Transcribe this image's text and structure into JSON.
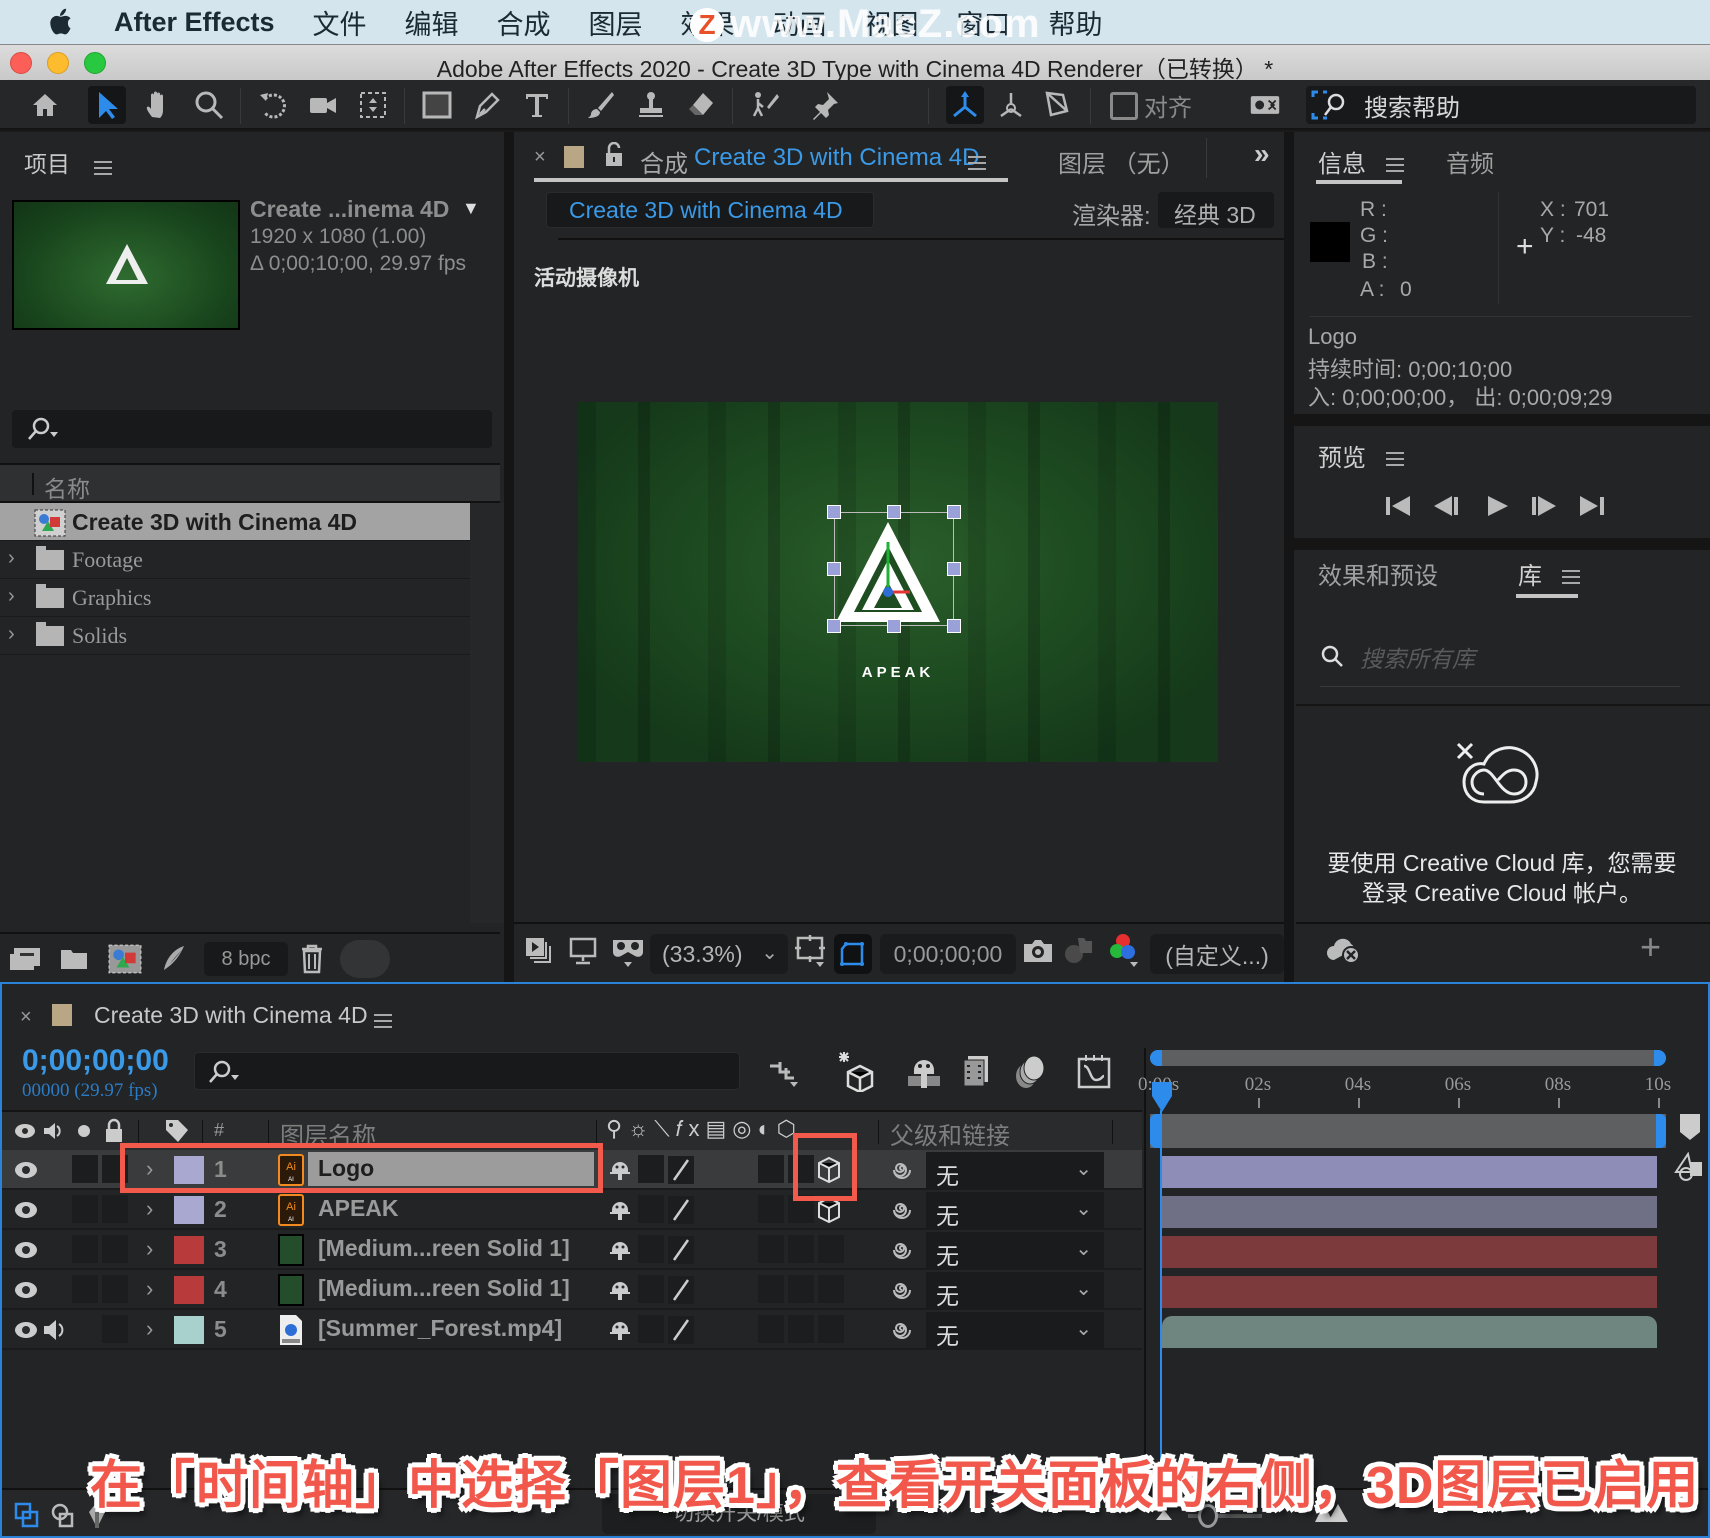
{
  "menubar": {
    "app_name": "After Effects",
    "items": [
      "文件",
      "编辑",
      "合成",
      "图层",
      "效果",
      "动画",
      "视图",
      "窗口",
      "帮助"
    ],
    "watermark": "www.MacZ.com",
    "watermark_badge": "Z"
  },
  "window": {
    "title": "Adobe After Effects 2020 - Create 3D Type with Cinema 4D Renderer（已转换） *"
  },
  "toolbar": {
    "align_label": "对齐",
    "search_help_label": "搜索帮助"
  },
  "project": {
    "title": "项目",
    "comp_name": "Create ...inema 4D",
    "comp_resolution": "1920 x 1080 (1.00)",
    "comp_duration": "Δ 0;00;10;00, 29.97 fps",
    "name_header": "名称",
    "items": [
      {
        "label": "Create 3D with Cinema 4D",
        "type": "composition",
        "selected": true
      },
      {
        "label": "Footage",
        "type": "folder"
      },
      {
        "label": "Graphics",
        "type": "folder"
      },
      {
        "label": "Solids",
        "type": "folder"
      }
    ],
    "bpc_label": "8 bpc"
  },
  "composition": {
    "tab_prefix": "合成",
    "tab_name": "Create 3D with Cinema 4D",
    "layer_tab": "图层 （无）",
    "breadcrumb": "Create 3D with Cinema 4D",
    "renderer_label": "渲染器:",
    "renderer_value": "经典 3D",
    "camera_label": "活动摄像机",
    "viewer_text": "APEAK",
    "zoom_value": "(33.3%)",
    "timecode": "0;00;00;00",
    "view_option": "(自定义...)"
  },
  "info": {
    "tab_info": "信息",
    "tab_audio": "音频",
    "r_label": "R :",
    "g_label": "G :",
    "b_label": "B :",
    "a_label": "A :",
    "a_value": "0",
    "x_label": "X :",
    "x_value": "701",
    "y_label": "Y :",
    "y_value": "-48",
    "layer_name": "Logo",
    "duration": "持续时间: 0;00;10;00",
    "in_out": "入: 0;00;00;00，  出: 0;00;09;29"
  },
  "preview": {
    "title": "预览"
  },
  "libraries": {
    "tab_effects": "效果和预设",
    "tab_library": "库",
    "search_placeholder": "搜索所有库",
    "message_line1": "要使用 Creative Cloud 库，您需要",
    "message_line2": "登录 Creative Cloud 帐户。"
  },
  "timeline": {
    "tab_name": "Create 3D with Cinema 4D",
    "timecode": "0;00;00;00",
    "frame_info": "00000 (29.97 fps)",
    "col_hash": "#",
    "col_layer_name": "图层名称",
    "col_parent": "父级和链接",
    "ruler_ticks": [
      "0:00s",
      "02s",
      "04s",
      "06s",
      "08s",
      "10s"
    ],
    "layers": [
      {
        "num": "1",
        "name": "Logo",
        "label_color": "#a8a8d0",
        "source": "ai",
        "parent": "无",
        "three_d": true,
        "selected": true,
        "bar_color": "#8d8db8",
        "audio": false
      },
      {
        "num": "2",
        "name": "APEAK",
        "label_color": "#a8a8d0",
        "source": "ai",
        "parent": "无",
        "three_d": true,
        "selected": false,
        "bar_color": "#6f6f85",
        "audio": false
      },
      {
        "num": "3",
        "name": "[Medium...reen Solid 1]",
        "label_color": "#b83a3a",
        "source": "solid",
        "parent": "无",
        "three_d": false,
        "selected": false,
        "bar_color": "#7c3a3c",
        "audio": false
      },
      {
        "num": "4",
        "name": "[Medium...reen Solid 1]",
        "label_color": "#b83a3a",
        "source": "solid",
        "parent": "无",
        "three_d": false,
        "selected": false,
        "bar_color": "#7c3a3c",
        "audio": false
      },
      {
        "num": "5",
        "name": "[Summer_Forest.mp4]",
        "label_color": "#a8d0cc",
        "source": "video",
        "parent": "无",
        "three_d": false,
        "selected": false,
        "bar_color": "#6f8580",
        "audio": true
      }
    ],
    "toggle_mode_label": "切换开关/模式"
  },
  "annotation": {
    "caption": "在「时间轴」中选择「图层1」，查看开关面板的右侧，3D图层已启用",
    "highlight_color": "#f25a4c"
  }
}
